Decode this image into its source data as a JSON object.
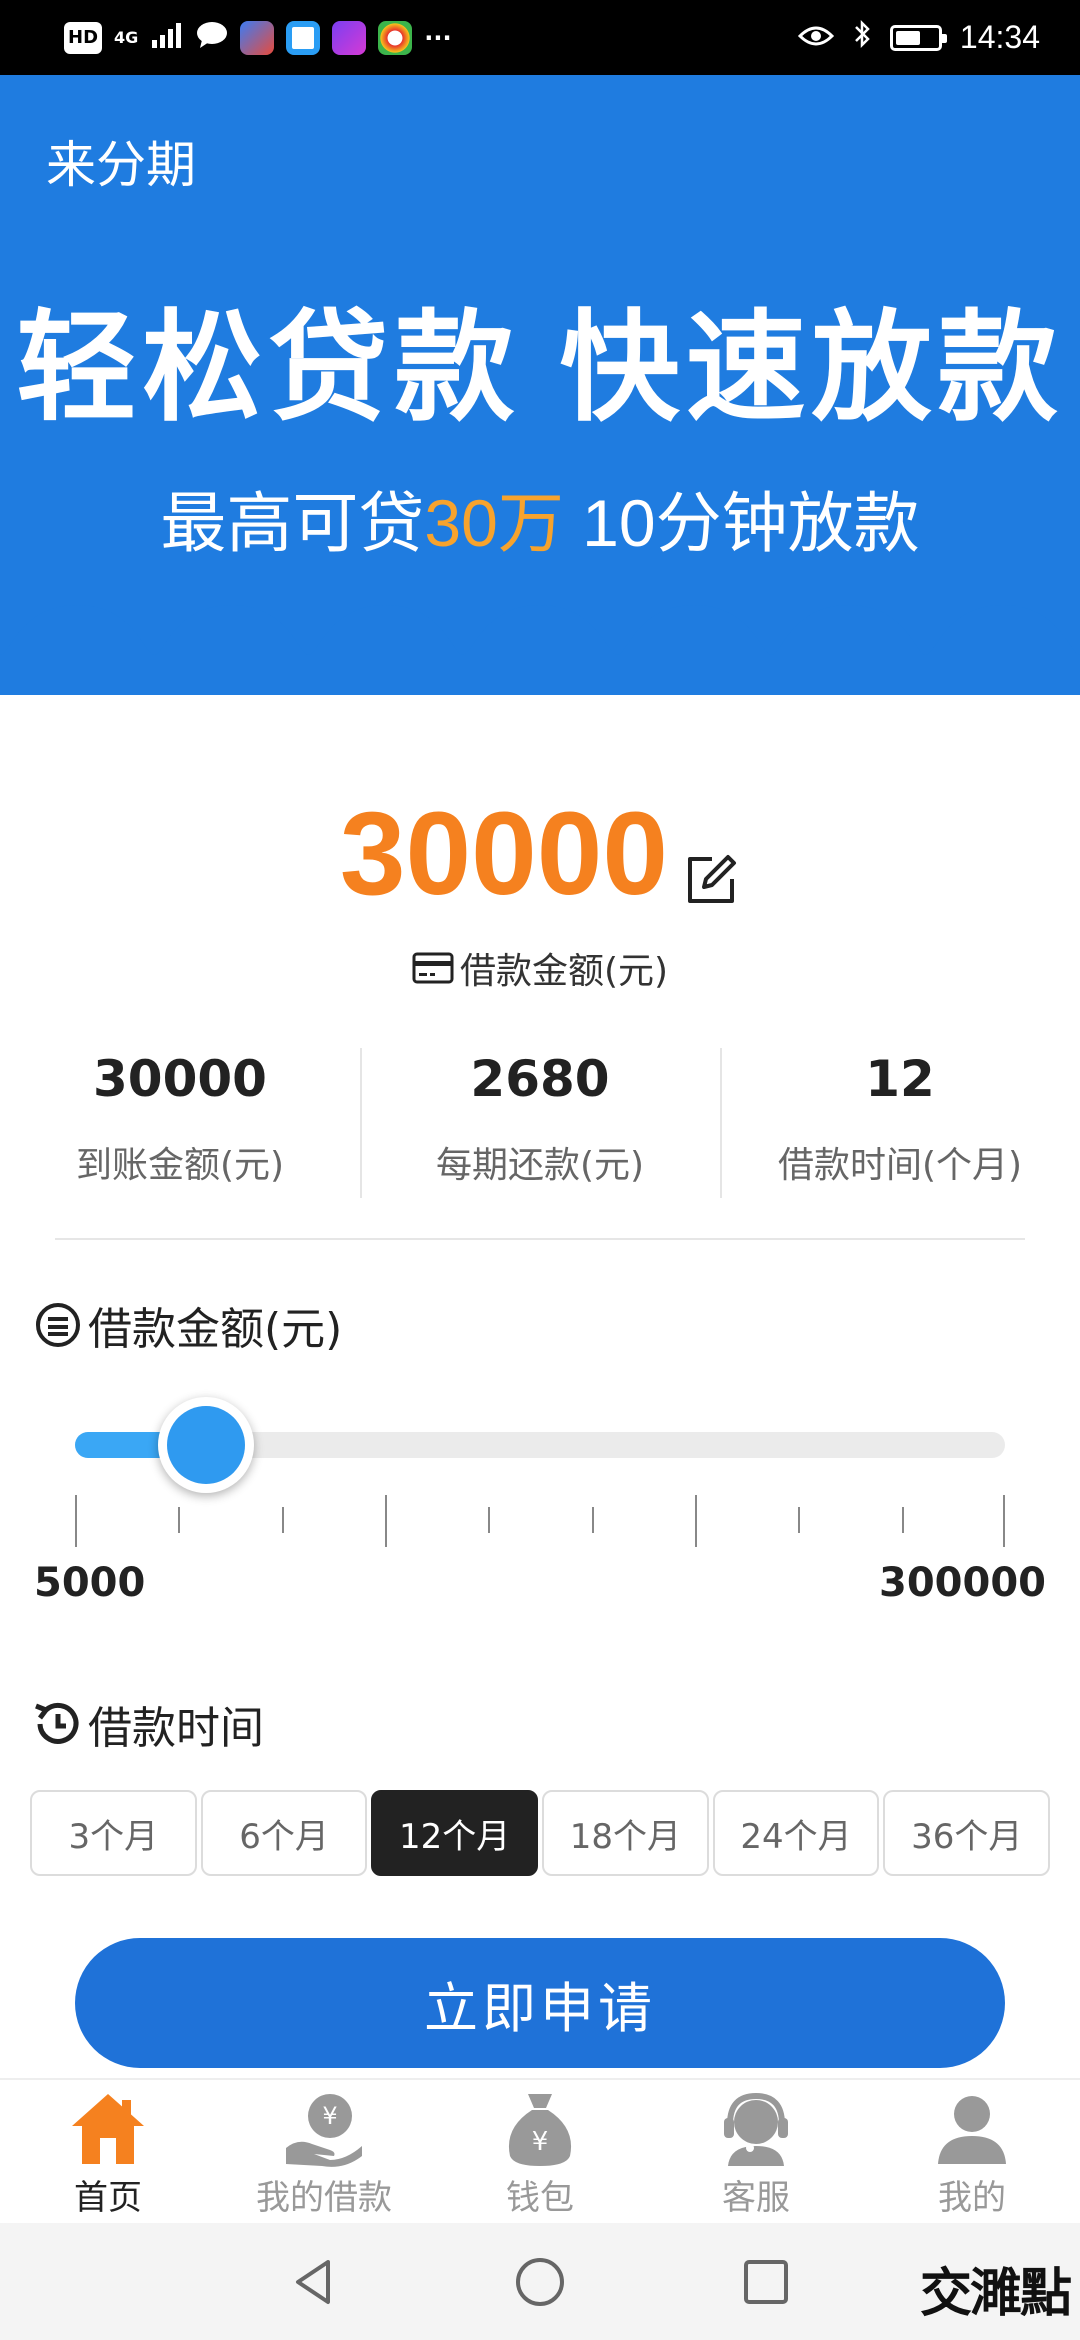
{
  "status_bar": {
    "left_badges": [
      "HD",
      "4G"
    ],
    "time": "14:34",
    "battery_level": 0.6
  },
  "banner": {
    "brand": "来分期",
    "headline": "轻松贷款 快速放款",
    "sub_prefix": "最高可贷",
    "sub_highlight": "30万",
    "sub_suffix": " 10分钟放款",
    "colors": {
      "background": "#1f7ce0",
      "highlight": "#f7a32d"
    }
  },
  "loan": {
    "amount": "30000",
    "amount_label": "借款金额(元)",
    "amount_color": "#f5811f"
  },
  "stats": [
    {
      "value": "30000",
      "label": "到账金额(元)"
    },
    {
      "value": "2680",
      "label": "每期还款(元)"
    },
    {
      "value": "12",
      "label": "借款时间(个月)"
    }
  ],
  "slider_section": {
    "title": "借款金额(元)",
    "min_label": "5000",
    "max_label": "300000",
    "min": 5000,
    "max": 300000,
    "value": 30000
  },
  "term_section": {
    "title": "借款时间",
    "options": [
      "3个月",
      "6个月",
      "12个月",
      "18个月",
      "24个月",
      "36个月"
    ],
    "selected": "12个月"
  },
  "apply_button": "立即申请",
  "tabbar": [
    {
      "label": "首页",
      "icon": "home-icon",
      "active": true
    },
    {
      "label": "我的借款",
      "icon": "loan-hand-icon",
      "active": false
    },
    {
      "label": "钱包",
      "icon": "money-bag-icon",
      "active": false
    },
    {
      "label": "客服",
      "icon": "customer-service-icon",
      "active": false
    },
    {
      "label": "我的",
      "icon": "user-icon",
      "active": false
    }
  ],
  "watermark": "交濉點"
}
